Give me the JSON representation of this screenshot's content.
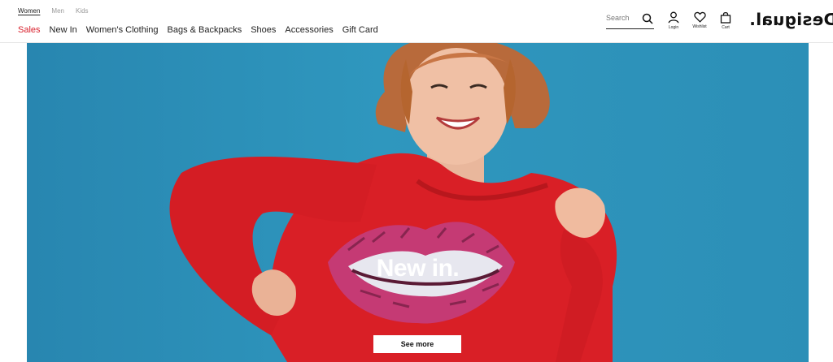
{
  "gender_tabs": [
    {
      "label": "Women",
      "active": true
    },
    {
      "label": "Men",
      "active": false
    },
    {
      "label": "Kids",
      "active": false
    }
  ],
  "nav": [
    {
      "label": "Sales",
      "sale": true
    },
    {
      "label": "New In"
    },
    {
      "label": "Women's Clothing"
    },
    {
      "label": "Bags & Backpacks"
    },
    {
      "label": "Shoes"
    },
    {
      "label": "Accessories"
    },
    {
      "label": "Gift Card"
    }
  ],
  "search": {
    "placeholder": "Search",
    "icon": "search-icon"
  },
  "actions": {
    "login": "Login",
    "wishlist": "Wishlist",
    "cart": "Cart"
  },
  "brand": {
    "logo_text": "Desigual."
  },
  "hero": {
    "title": "New in.",
    "cta": "See more"
  },
  "colors": {
    "sale": "#d81e2a",
    "hero_bg": "#2f97be",
    "sweater": "#d91f26"
  }
}
